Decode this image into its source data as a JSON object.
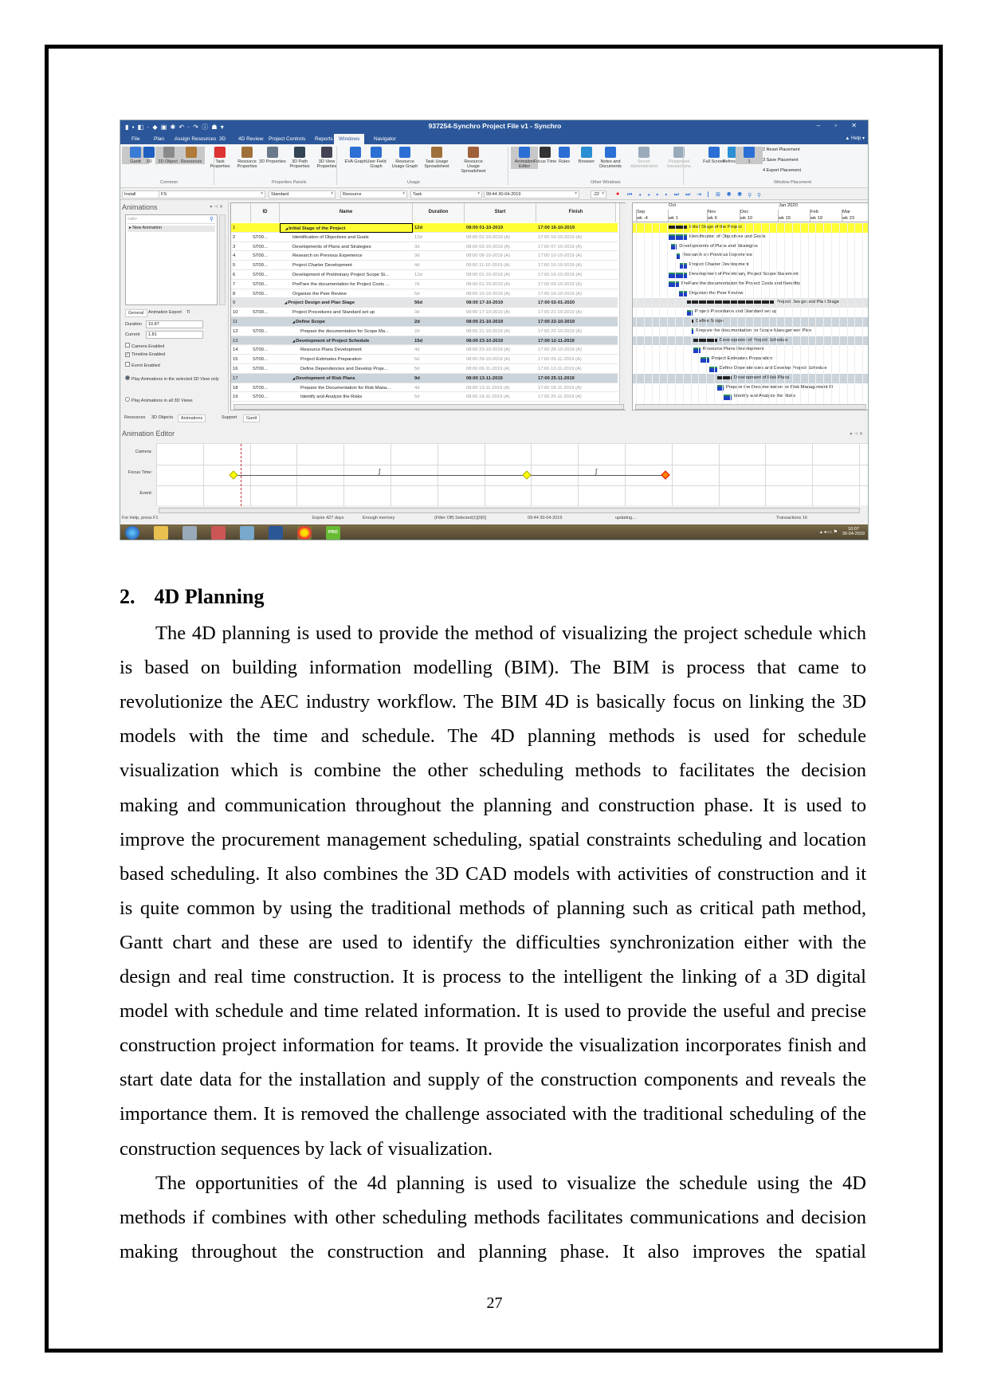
{
  "app": {
    "window_title": "937254-Synchro Project File v1 - Synchro",
    "menu_tabs": [
      "File",
      "Plan",
      "Assign Resources",
      "3D",
      "4D Review",
      "Project Controls",
      "Reports",
      "Windows",
      "Navigator"
    ],
    "active_tab": "Windows",
    "help": "▲ Help ▾",
    "ribbon_buttons": [
      {
        "label": "Gantt",
        "group": "Common",
        "selected": true,
        "icon": "gantt-icon"
      },
      {
        "label": "3D",
        "group": "Common",
        "icon": "3d-icon"
      },
      {
        "label": "3D Objects",
        "group": "Common",
        "selected": true,
        "icon": "3d-objects-icon"
      },
      {
        "label": "Resources",
        "group": "Common",
        "selected": true,
        "icon": "resources-icon"
      },
      {
        "label": "Task Properties",
        "group": "Properties Panels",
        "icon": "task-properties-icon"
      },
      {
        "label": "Resource Properties",
        "group": "Properties Panels",
        "icon": "resource-properties-icon"
      },
      {
        "label": "3D Properties",
        "group": "Properties Panels",
        "icon": "3d-properties-icon"
      },
      {
        "label": "3D Path Properties",
        "group": "Properties Panels",
        "icon": "3d-path-icon"
      },
      {
        "label": "3D View Properties",
        "group": "Properties Panels",
        "icon": "3d-view-icon"
      },
      {
        "label": "EVA Graph",
        "group": "Usage",
        "icon": "eva-graph-icon"
      },
      {
        "label": "User Field Graph",
        "group": "Usage",
        "icon": "user-field-graph-icon"
      },
      {
        "label": "Resource Usage Graph",
        "group": "Usage",
        "icon": "resource-usage-graph-icon"
      },
      {
        "label": "Task Usage Spreadsheet",
        "group": "Usage",
        "icon": "task-usage-icon"
      },
      {
        "label": "Resource Usage Spreadsheet",
        "group": "Usage",
        "icon": "resource-usage-spreadsheet-icon"
      },
      {
        "label": "Animation Editor",
        "group": "Other Windows",
        "selected": true,
        "icon": "animation-editor-icon"
      },
      {
        "label": "Focus Time",
        "group": "Other Windows",
        "icon": "clock-icon"
      },
      {
        "label": "Rules",
        "group": "Other Windows",
        "icon": "rules-icon"
      },
      {
        "label": "Browser",
        "group": "Other Windows",
        "icon": "globe-icon"
      },
      {
        "label": "Notes and Documents",
        "group": "Other Windows",
        "icon": "notes-icon"
      },
      {
        "label": "Server Administration",
        "group": "Other Windows",
        "disabled": true,
        "icon": "server-icon"
      },
      {
        "label": "Postponed transactions",
        "group": "Other Windows",
        "disabled": true,
        "icon": "postponed-icon"
      },
      {
        "label": "Full Screen",
        "group": "Window Placement",
        "icon": "full-screen-icon"
      },
      {
        "label": "Refresh All",
        "group": "Window Placement",
        "icon": "refresh-icon"
      },
      {
        "label": "1",
        "group": "Window Placement",
        "selected": true,
        "icon": "placement-1-icon"
      }
    ],
    "placement_items": [
      "2 Reset Placement",
      "3 Save Placement",
      "4 Export Placement"
    ],
    "ribbon_groups": [
      "Common",
      "Properties Panels",
      "Usage",
      "Other Windows",
      "Window Placement"
    ],
    "toolbar": {
      "combos": [
        "Install",
        "FS",
        "Standard",
        "Resource",
        "Task"
      ],
      "datetime": "09:44 30-04-2019",
      "offset": "-22"
    },
    "animations_panel": {
      "title": "Animations",
      "filter": "<all>",
      "items": [
        "New Animation"
      ],
      "tabs": [
        "General",
        "Animation Export",
        "Ti"
      ],
      "duration_label": "Duration",
      "duration": "10.87",
      "current_label": "Current",
      "current": "1.81",
      "checks": [
        {
          "label": "Camera Enabled",
          "checked": false
        },
        {
          "label": "Timeline Enabled",
          "checked": true
        },
        {
          "label": "Event Enabled",
          "checked": false
        }
      ],
      "radios": [
        {
          "label": "Play Animations in the selected 3D View only",
          "checked": true
        },
        {
          "label": "Play Animations in all 3D Views",
          "checked": false
        }
      ]
    },
    "table": {
      "columns": [
        "ID",
        "Name",
        "Duration",
        "Start",
        "Finish"
      ],
      "rows": [
        {
          "n": "1",
          "id": "",
          "name": "Initial Stage of the Project",
          "dur": "12d",
          "start": "08:00 01-10-2019",
          "finish": "17:00 16-10-2019",
          "level": 0,
          "summary": true,
          "highlight": true
        },
        {
          "n": "2",
          "id": "ST00...",
          "name": "Identification of Objectives and Goals",
          "dur": "12d",
          "start": "08:00 01-10-2019 (A)",
          "finish": "17:00 16-10-2019 (A)",
          "level": 1
        },
        {
          "n": "3",
          "id": "ST00...",
          "name": "Developments of Plans and Strategies",
          "dur": "3d",
          "start": "08:00 03-10-2019 (A)",
          "finish": "17:00 07-10-2019 (A)",
          "level": 1
        },
        {
          "n": "4",
          "id": "ST00...",
          "name": "Research on Previous Experience",
          "dur": "3d",
          "start": "08:00 08-10-2019 (A)",
          "finish": "17:00 10-10-2019 (A)",
          "level": 1
        },
        {
          "n": "5",
          "id": "ST00...",
          "name": "Project Charter Development",
          "dur": "4d",
          "start": "08:00 11-10-2019 (A)",
          "finish": "17:00 16-10-2019 (A)",
          "level": 1
        },
        {
          "n": "6",
          "id": "ST00...",
          "name": "Development of Preliminary Project Scope St...",
          "gantt": "Development of Preliminary Project Scope Statement",
          "dur": "12d",
          "start": "08:00 01-10-2019 (A)",
          "finish": "17:00 16-10-2019 (A)",
          "level": 1
        },
        {
          "n": "7",
          "id": "ST00...",
          "name": "PrePare the documentation for Project Costs ...",
          "gantt": "PrePare the documentation for Project Costs and Benefits",
          "dur": "7d",
          "start": "08:00 01-10-2019 (A)",
          "finish": "17:00 09-10-2019 (A)",
          "level": 1
        },
        {
          "n": "8",
          "id": "ST00...",
          "name": "Organize the Peer Review",
          "dur": "5d",
          "start": "08:00 10-10-2019 (A)",
          "finish": "17:00 16-10-2019 (A)",
          "level": 1
        },
        {
          "n": "9",
          "id": "",
          "name": "Project Design and Plan Stage",
          "dur": "56d",
          "start": "08:00 17-10-2019",
          "finish": "17:00 02-01-2020",
          "level": 0,
          "summary": true,
          "tone": "light"
        },
        {
          "n": "10",
          "id": "ST00...",
          "name": "Project Procedures and Standard set up",
          "dur": "3d",
          "start": "08:00 17-10-2019 (A)",
          "finish": "17:00 21-10-2019 (A)",
          "level": 1
        },
        {
          "n": "11",
          "id": "",
          "name": "Define Scope",
          "dur": "2d",
          "start": "08:00 21-10-2019",
          "finish": "17:00 22-10-2019",
          "level": 1,
          "summary": true
        },
        {
          "n": "12",
          "id": "ST00...",
          "name": "Prepare the documentation for Scope Ma...",
          "gantt": "Prepare the documentation for Scope Management Plan",
          "dur": "2d",
          "start": "08:00 21-10-2019 (A)",
          "finish": "17:00 22-10-2019 (A)",
          "level": 2
        },
        {
          "n": "13",
          "id": "",
          "name": "Development of Project Schedule",
          "dur": "15d",
          "start": "08:00 23-10-2019",
          "finish": "17:00 12-11-2019",
          "level": 1,
          "summary": true
        },
        {
          "n": "14",
          "id": "ST00...",
          "name": "Resource Plans Development",
          "dur": "4d",
          "start": "08:00 23-10-2019 (A)",
          "finish": "17:00 28-10-2019 (A)",
          "level": 2
        },
        {
          "n": "15",
          "id": "ST00...",
          "name": "Project Estimates Preparation",
          "dur": "6d",
          "start": "08:00 29-10-2019 (A)",
          "finish": "17:00 05-11-2019 (A)",
          "level": 2
        },
        {
          "n": "16",
          "id": "ST00...",
          "name": "Define Dependencies and Develop Proje...",
          "gantt": "Define Dependencies and Develop Project Schedule",
          "dur": "5d",
          "start": "08:00 06-11-2019 (A)",
          "finish": "17:00 12-11-2019 (A)",
          "level": 2
        },
        {
          "n": "17",
          "id": "",
          "name": "Development of Risk Plans",
          "dur": "9d",
          "start": "08:00 13-11-2019",
          "finish": "17:00 25-11-2019",
          "level": 1,
          "summary": true
        },
        {
          "n": "18",
          "id": "ST00...",
          "name": "Prepare the Documentation for Risk Mana...",
          "gantt": "Prepare the Documentation for Risk Management Pl",
          "dur": "4d",
          "start": "08:00 13-11-2019 (A)",
          "finish": "17:00 18-11-2019 (A)",
          "level": 2
        },
        {
          "n": "19",
          "id": "ST00...",
          "name": "Identify and Analyze the Risks",
          "dur": "5d",
          "start": "08:00 19-11-2019 (A)",
          "finish": "17:00 25-11-2019 (A)",
          "level": 2
        }
      ]
    },
    "gantt_header": {
      "top": [
        "Oct",
        "Jan 2020"
      ],
      "months": [
        "Sep",
        "Nov",
        "Dec",
        "Feb",
        "Mar"
      ],
      "weeks": [
        "wk -4",
        "wk 1",
        "wk 6",
        "wk 10",
        "wk 15",
        "wk 19",
        "wk 23"
      ]
    },
    "bottom_tabs_left": [
      "Resources",
      "3D Objects",
      "Animations"
    ],
    "bottom_tabs_mid": [
      "Support",
      "Gantt"
    ],
    "animation_editor": {
      "title": "Animation Editor",
      "rows": [
        "Camera:",
        "Focus Time:",
        "Event:"
      ]
    },
    "status": [
      "For Help, press F1",
      "Expire 427 days",
      "Enough memory",
      "(Filter Off) Selected(1)[0|0]",
      "09:44 30-04-2019",
      "updating...",
      "Transactions 16"
    ],
    "taskbar": {
      "apps": [
        "start-orb",
        "file-explorer",
        "calculator",
        "paint",
        "notepad",
        "word",
        "chrome",
        "project-pro"
      ],
      "pro_label": "PRO",
      "clock_time": "10:07",
      "clock_date": "30-04-2019"
    },
    "colors": {
      "titlebar": "#2b579a",
      "highlight_row": "#ffff33",
      "summary_row": "#ccd4db",
      "task_bar": "#1c3fc4",
      "summary_bar": "#222222"
    }
  },
  "document": {
    "heading_number": "2.",
    "heading_title": "4D Planning",
    "paragraphs": [
      [
        "The 4D planning is used to provide the method of visualizing the project schedule which",
        "is based on building information modelling (BIM). The BIM is process that came to",
        "revolutionize the AEC industry workflow.  The BIM 4D is basically focus on linking the 3D",
        "models with the time and schedule. The 4D planning methods is used for schedule",
        "visualization which is combine the other scheduling methods to facilitates the decision",
        "making and communication throughout the planning and construction phase. It is used to",
        "improve the procurement management scheduling, spatial constraints scheduling and location",
        "based scheduling. It also combines the 3D CAD models with activities of construction and it",
        "is quite common by using the traditional methods of planning such as critical path method,",
        "Gantt chart and these are used to identify the difficulties synchronization either with the",
        "design and real time construction. It is process to the intelligent the linking of a 3D digital",
        "model with schedule and time related information. It is used to provide the useful and precise",
        "construction project information for teams. It provide the visualization incorporates finish and",
        "start date data for the installation and supply of the construction components and reveals the",
        "importance them. It is removed the challenge associated with the traditional scheduling of the",
        "construction sequences by lack of visualization."
      ],
      [
        "The opportunities of the 4d planning is used to visualize the schedule using the 4D",
        "methods if combines with other scheduling methods facilitates communications and decision",
        "making throughout the construction and planning phase. It also improves the spatial"
      ]
    ],
    "page_number": "27"
  }
}
